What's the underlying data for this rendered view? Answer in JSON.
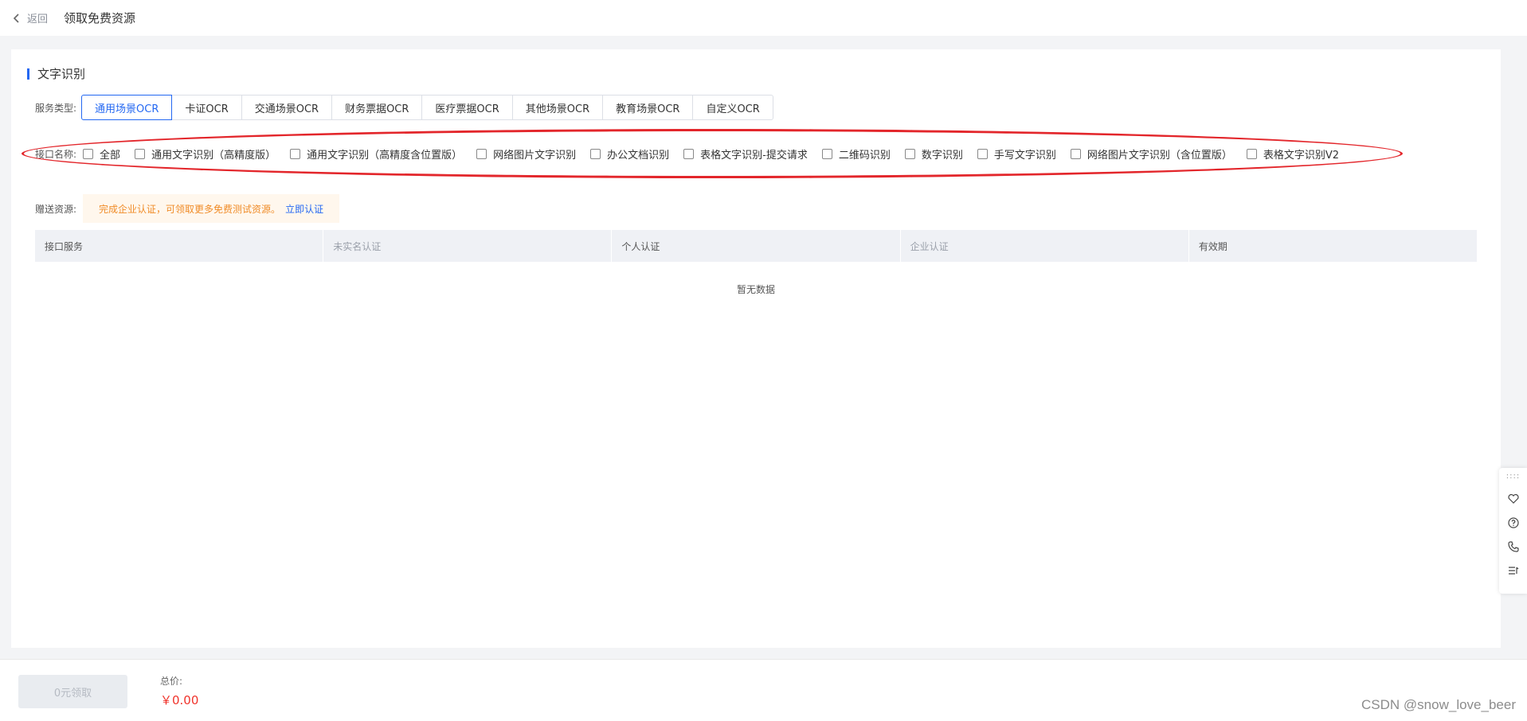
{
  "header": {
    "back_label": "返回",
    "title": "领取免费资源"
  },
  "section": {
    "title": "文字识别"
  },
  "service": {
    "label": "服务类型:",
    "tabs": [
      {
        "label": "通用场景OCR",
        "active": true
      },
      {
        "label": "卡证OCR",
        "active": false
      },
      {
        "label": "交通场景OCR",
        "active": false
      },
      {
        "label": "财务票据OCR",
        "active": false
      },
      {
        "label": "医疗票据OCR",
        "active": false
      },
      {
        "label": "其他场景OCR",
        "active": false
      },
      {
        "label": "教育场景OCR",
        "active": false
      },
      {
        "label": "自定义OCR",
        "active": false
      }
    ]
  },
  "interface": {
    "label": "接口名称:",
    "items": [
      {
        "label": "全部",
        "checked": false
      },
      {
        "label": "通用文字识别（高精度版）",
        "checked": false
      },
      {
        "label": "通用文字识别（高精度含位置版）",
        "checked": false
      },
      {
        "label": "网络图片文字识别",
        "checked": false
      },
      {
        "label": "办公文档识别",
        "checked": false
      },
      {
        "label": "表格文字识别-提交请求",
        "checked": false
      },
      {
        "label": "二维码识别",
        "checked": false
      },
      {
        "label": "数字识别",
        "checked": false
      },
      {
        "label": "手写文字识别",
        "checked": false
      },
      {
        "label": "网络图片文字识别（含位置版）",
        "checked": false
      },
      {
        "label": "表格文字识别V2",
        "checked": false
      }
    ]
  },
  "gift": {
    "label": "赠送资源:",
    "notice": "完成企业认证，可领取更多免费测试资源。",
    "link": "立即认证"
  },
  "table": {
    "columns": [
      "接口服务",
      "未实名认证",
      "个人认证",
      "企业认证",
      "有效期"
    ],
    "empty_text": "暂无数据"
  },
  "side_tools": {
    "icons": [
      "heart-icon",
      "help-icon",
      "phone-icon",
      "list-icon"
    ]
  },
  "footer": {
    "claim_button": "0元领取",
    "total_label": "总价:",
    "total_value": "￥0.00"
  },
  "watermark": "CSDN @snow_love_beer",
  "colors": {
    "accent": "#2468f2",
    "highlight": "#e3262b",
    "price": "#f0332b",
    "notice_text": "#f08c28",
    "notice_bg": "#fff7ed"
  }
}
